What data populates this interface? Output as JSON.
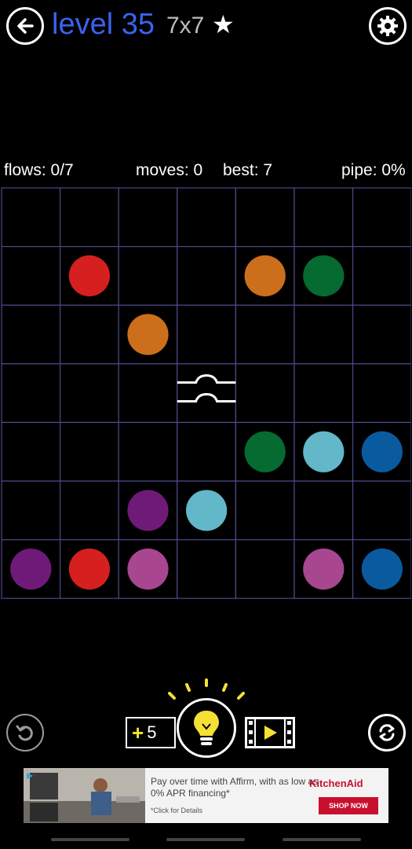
{
  "header": {
    "level_label": "level 35",
    "size_label": "7x7",
    "star": "★",
    "back_icon": "back-arrow-icon",
    "settings_icon": "gear-icon"
  },
  "stats": {
    "flows": "flows: 0/7",
    "moves": "moves: 0",
    "best": "best: 7",
    "pipe": "pipe: 0%"
  },
  "board": {
    "rows": 7,
    "cols": 7,
    "grid_color": "#4a4a8a",
    "bridge": {
      "row": 3,
      "col": 3
    },
    "dots": [
      {
        "row": 1,
        "col": 1,
        "color": "#d61f1f"
      },
      {
        "row": 1,
        "col": 4,
        "color": "#cc6f1c"
      },
      {
        "row": 1,
        "col": 5,
        "color": "#056b30"
      },
      {
        "row": 2,
        "col": 2,
        "color": "#cc6f1c"
      },
      {
        "row": 4,
        "col": 4,
        "color": "#056b30"
      },
      {
        "row": 4,
        "col": 5,
        "color": "#62b8c8"
      },
      {
        "row": 4,
        "col": 6,
        "color": "#0a5aa0"
      },
      {
        "row": 5,
        "col": 2,
        "color": "#6f1a78"
      },
      {
        "row": 5,
        "col": 3,
        "color": "#62b8c8"
      },
      {
        "row": 6,
        "col": 0,
        "color": "#6f1a78"
      },
      {
        "row": 6,
        "col": 1,
        "color": "#d61f1f"
      },
      {
        "row": 6,
        "col": 2,
        "color": "#a8468f"
      },
      {
        "row": 6,
        "col": 5,
        "color": "#a8468f"
      },
      {
        "row": 6,
        "col": 6,
        "color": "#0a5aa0"
      }
    ]
  },
  "controls": {
    "hints_count": "5",
    "plus": "+",
    "undo_icon": "undo-icon",
    "hint_icon": "lightbulb-icon",
    "video_icon": "video-play-icon",
    "reset_icon": "refresh-icon"
  },
  "ad": {
    "text": "Pay over time with Affirm, with as low as 0% APR financing*",
    "fine_print": "*Click for Details",
    "brand": "KitchenAid",
    "cta": "SHOP NOW"
  }
}
